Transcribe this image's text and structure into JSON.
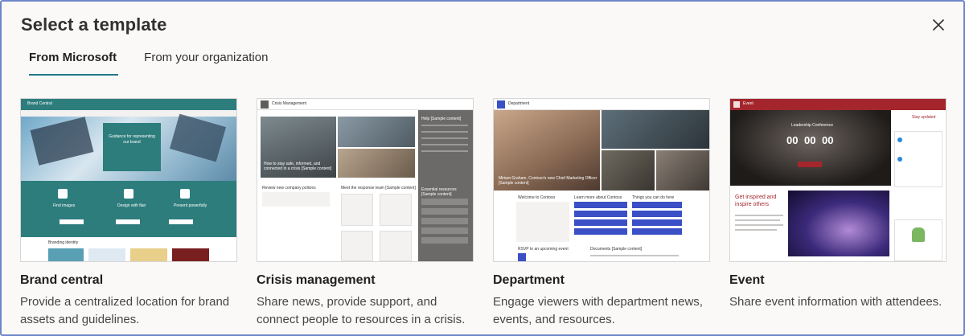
{
  "dialog": {
    "title": "Select a template",
    "close_icon": "close-icon"
  },
  "tabs": [
    {
      "label": "From Microsoft",
      "selected": true
    },
    {
      "label": "From your organization",
      "selected": false
    }
  ],
  "templates": [
    {
      "title": "Brand central",
      "description": "Provide a centralized location for brand assets and guidelines.",
      "thumb": {
        "site_name": "Brand Central",
        "hero_text": "Guidance for representing our brand",
        "features": [
          "Find images",
          "Design with flair",
          "Present powerfully"
        ],
        "section": "Branding identity",
        "accent": "#2e7d7d"
      }
    },
    {
      "title": "Crisis management",
      "description": "Share news, provide support, and connect people to resources in a crisis.",
      "thumb": {
        "site_name": "Crisis Management",
        "hero_caption": "How to stay safe, informed, and connected in a crisis [Sample content]",
        "side_title": "Help [Sample content]",
        "section_a": "Review new company policies",
        "section_b": "Meet the response team [Sample content]",
        "section_c": "Essential resources [Sample content]",
        "accent": "#5f5e5e"
      }
    },
    {
      "title": "Department",
      "description": "Engage viewers with department news, events, and resources.",
      "thumb": {
        "site_name": "Department",
        "hero_caption": "Miriam Graham, Contoso's new Chief Marketing Officer [Sample content]",
        "welcome": "Welcome to Contoso",
        "learn": "Learn more about Contoso",
        "things": "Things you can do here",
        "rsvp": "RSVP to an upcoming event",
        "documents": "Documents [Sample content]",
        "accent": "#3b4fc6"
      }
    },
    {
      "title": "Event",
      "description": "Share event information with attendees.",
      "thumb": {
        "site_name": "Event",
        "hero_title": "Leadership Conference",
        "countdown": [
          "00",
          "00",
          "00"
        ],
        "stay_updated": "Stay updated",
        "inspire": "Get inspired and inspire others",
        "accent": "#a4262c"
      }
    }
  ]
}
